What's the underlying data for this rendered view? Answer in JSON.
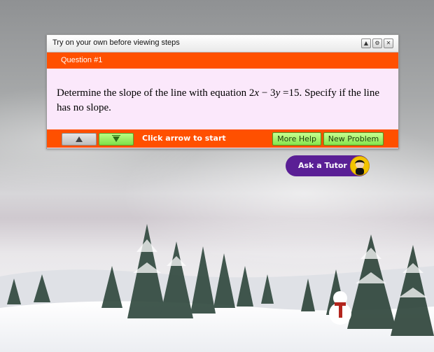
{
  "panel": {
    "title": "Try on your own  before viewing steps",
    "window_buttons": [
      "minimize-icon",
      "settings-icon",
      "close-icon"
    ],
    "question_label": "Question #1",
    "question_text_html": "Determine the slope of the line with equation 2<i>x</i> − 3<i>y</i> =15. Specify if the line has no slope.",
    "hint": "Click arrow to start",
    "more_help": "More Help",
    "new_problem": "New Problem"
  },
  "tutor_button": {
    "label": "Ask a Tutor"
  },
  "colors": {
    "accent": "#ff5000",
    "tutor": "#5a1f95",
    "panel_bg": "#fbe8fb",
    "green_button": "#86e54b"
  }
}
